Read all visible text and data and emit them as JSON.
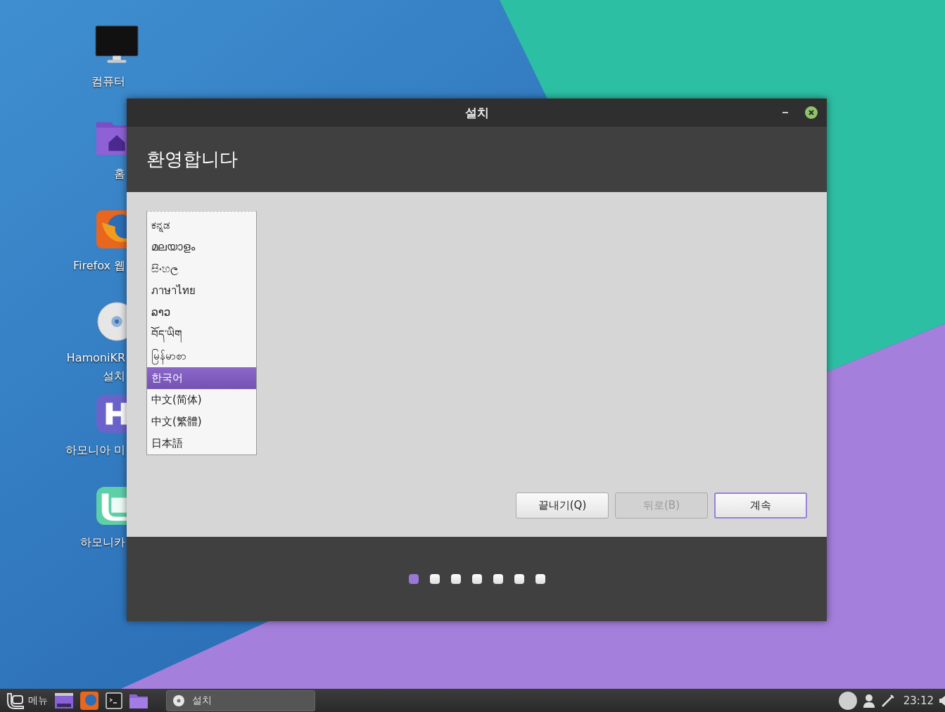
{
  "desktop_icons": [
    {
      "kind": "monitor",
      "label_lines": [
        "컴퓨터"
      ]
    },
    {
      "kind": "home-folder",
      "label_lines": [
        "홈"
      ]
    },
    {
      "kind": "browser",
      "label_lines": [
        "Firefox 웹"
      ]
    },
    {
      "kind": "disc",
      "label_lines": [
        "HamoniKR",
        "설치"
      ]
    },
    {
      "kind": "h-app",
      "label_lines": [
        "하모니아 미"
      ]
    },
    {
      "kind": "mint",
      "label_lines": [
        "하모니카"
      ]
    }
  ],
  "window": {
    "title": "설치",
    "heading": "환영합니다"
  },
  "languages": [
    {
      "name": "ಕನ್ನಡ",
      "selected": false
    },
    {
      "name": "മലയാളം",
      "selected": false
    },
    {
      "name": "සිංහල",
      "selected": false
    },
    {
      "name": "ภาษาไทย",
      "selected": false
    },
    {
      "name": "ລາວ",
      "selected": false
    },
    {
      "name": "བོད་ཡིག",
      "selected": false
    },
    {
      "name": "မြန်မာစာ",
      "selected": false
    },
    {
      "name": "한국어",
      "selected": true
    },
    {
      "name": "中文(简体)",
      "selected": false
    },
    {
      "name": "中文(繁體)",
      "selected": false
    },
    {
      "name": "日本語",
      "selected": false
    }
  ],
  "buttons": [
    {
      "label": "끝내기(Q)",
      "disabled": false,
      "default": false
    },
    {
      "label": "뒤로(B)",
      "disabled": true,
      "default": false
    },
    {
      "label": "계속",
      "disabled": false,
      "default": true
    }
  ],
  "steps": [
    {
      "selected": true
    },
    {
      "selected": false
    },
    {
      "selected": false
    },
    {
      "selected": false
    },
    {
      "selected": false
    },
    {
      "selected": false
    },
    {
      "selected": false
    }
  ],
  "taskbar": {
    "menu_label": "메뉴",
    "task_title": "설치",
    "clock": "23:12"
  }
}
